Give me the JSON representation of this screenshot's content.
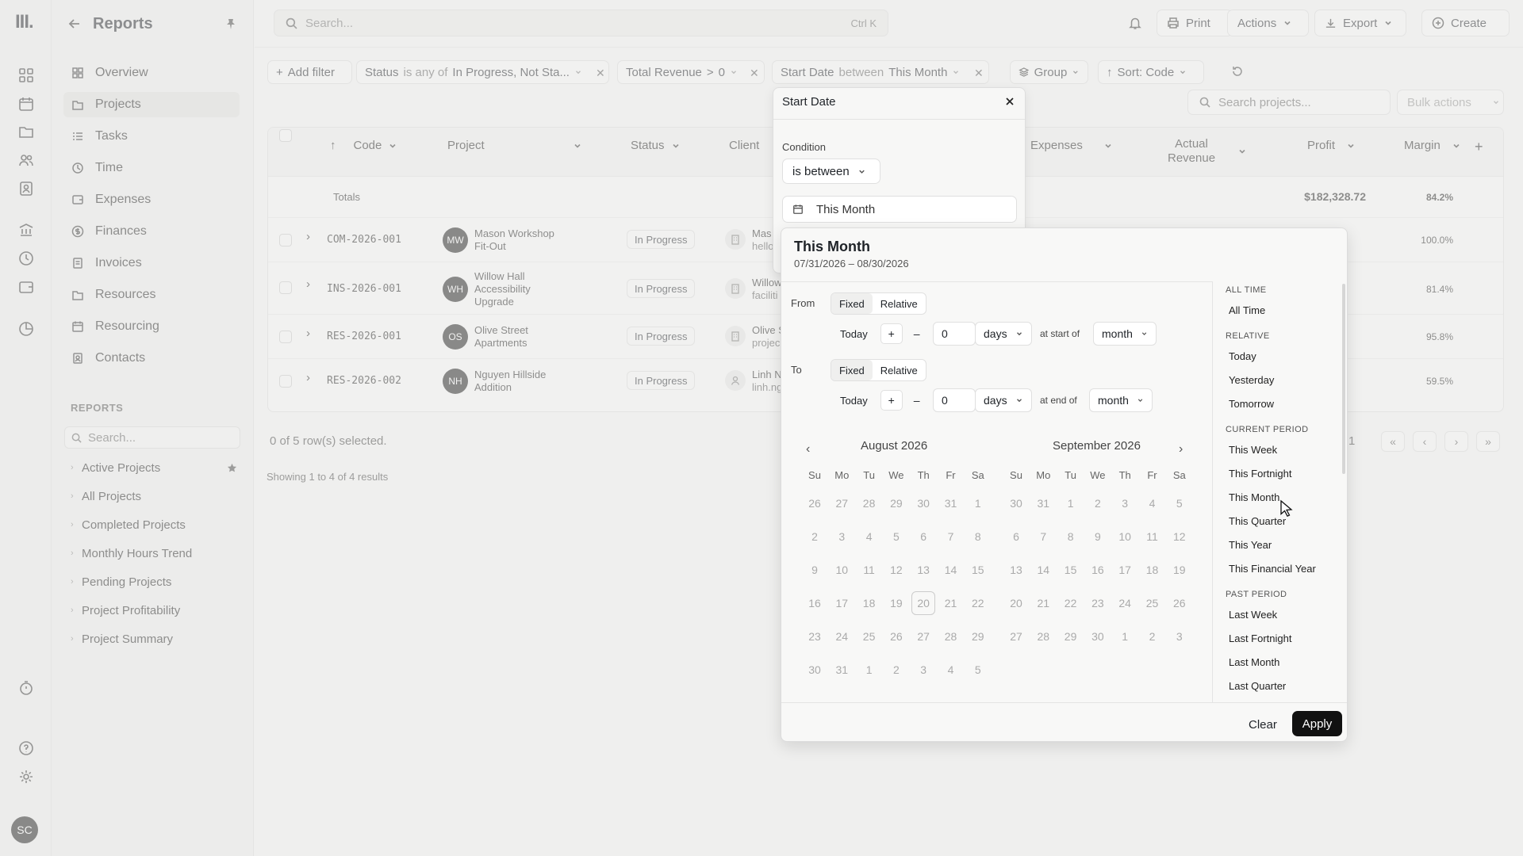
{
  "app": {
    "logo": "III.",
    "user_initials": "SC"
  },
  "sidebar": {
    "title": "Reports",
    "nav": [
      {
        "label": "Overview",
        "icon": "grid-icon"
      },
      {
        "label": "Projects",
        "icon": "projects-icon",
        "active": true
      },
      {
        "label": "Tasks",
        "icon": "tasks-icon"
      },
      {
        "label": "Time",
        "icon": "clock-icon"
      },
      {
        "label": "Expenses",
        "icon": "wallet-icon"
      },
      {
        "label": "Finances",
        "icon": "dollar-icon"
      },
      {
        "label": "Invoices",
        "icon": "invoice-icon"
      },
      {
        "label": "Resources",
        "icon": "folder-icon"
      },
      {
        "label": "Resourcing",
        "icon": "calendar-icon"
      },
      {
        "label": "Contacts",
        "icon": "contacts-icon"
      }
    ],
    "reports_label": "REPORTS",
    "reports_search_placeholder": "Search...",
    "reports": [
      "Active Projects",
      "All Projects",
      "Completed Projects",
      "Monthly Hours Trend",
      "Pending Projects",
      "Project Profitability",
      "Project Summary"
    ]
  },
  "topbar": {
    "search_placeholder": "Search...",
    "search_shortcut": "Ctrl K",
    "print": "Print",
    "actions": "Actions",
    "export": "Export",
    "create": "Create"
  },
  "filters": {
    "add_filter": "Add filter",
    "status": {
      "field": "Status",
      "op": "is any of",
      "value": "In Progress, Not Sta..."
    },
    "revenue": {
      "field": "Total Revenue",
      "op": ">",
      "value": "0"
    },
    "start_date": {
      "field": "Start Date",
      "op": "between",
      "value": "This Month"
    },
    "group": "Group",
    "sort": "Sort: Code"
  },
  "table": {
    "search_placeholder": "Search projects...",
    "bulk_actions": "Bulk actions",
    "columns": {
      "code": "Code",
      "project": "Project",
      "status": "Status",
      "client": "Client",
      "expenses": "Expenses",
      "actual_revenue_1": "Actual",
      "actual_revenue_2": "Revenue",
      "profit": "Profit",
      "margin": "Margin"
    },
    "totals": {
      "label": "Totals",
      "profit": "$182,328.72",
      "margin": "84.2%"
    },
    "rows": [
      {
        "code": "COM-2026-001",
        "initials": "MW",
        "project_1": "Mason Workshop",
        "project_2": "Fit-Out",
        "project_3": "",
        "status": "In Progress",
        "client_1": "Mas",
        "client_2": "hello",
        "client_icon": "building-icon",
        "margin": "100.0%"
      },
      {
        "code": "INS-2026-001",
        "initials": "WH",
        "project_1": "Willow Hall",
        "project_2": "Accessibility",
        "project_3": "Upgrade",
        "status": "In Progress",
        "client_1": "Willow",
        "client_2": "faciliti",
        "client_icon": "building-icon",
        "margin": "81.4%"
      },
      {
        "code": "RES-2026-001",
        "initials": "OS",
        "project_1": "Olive Street",
        "project_2": "Apartments",
        "project_3": "",
        "status": "In Progress",
        "client_1": "Olive S",
        "client_2": "projec",
        "client_icon": "building-icon",
        "margin": "95.8%"
      },
      {
        "code": "RES-2026-002",
        "initials": "NH",
        "project_1": "Nguyen Hillside",
        "project_2": "Addition",
        "project_3": "",
        "status": "In Progress",
        "client_1": "Linh N",
        "client_2": "linh.ng",
        "client_icon": "person-icon",
        "margin": "59.5%"
      }
    ],
    "selected_text": "0 of 5 row(s) selected.",
    "showing_text": "Showing 1 to 4 of 4 results",
    "page": "1"
  },
  "popover": {
    "title": "Start Date",
    "condition_label": "Condition",
    "condition_value": "is between",
    "date_value": "This Month"
  },
  "date_panel": {
    "title": "This Month",
    "range": "07/31/2026 – 08/30/2026",
    "from_label": "From",
    "to_label": "To",
    "fixed": "Fixed",
    "relative": "Relative",
    "today": "Today",
    "plus": "+",
    "minus": "–",
    "from_amount": "0",
    "to_amount": "0",
    "unit": "days",
    "at_start_of": "at start of",
    "at_end_of": "at end of",
    "period": "month",
    "cal_left_title": "August 2026",
    "cal_right_title": "September 2026",
    "weekdays": [
      "Su",
      "Mo",
      "Tu",
      "We",
      "Th",
      "Fr",
      "Sa"
    ],
    "aug_days": [
      "26",
      "27",
      "28",
      "29",
      "30",
      "31",
      "1",
      "2",
      "3",
      "4",
      "5",
      "6",
      "7",
      "8",
      "9",
      "10",
      "11",
      "12",
      "13",
      "14",
      "15",
      "16",
      "17",
      "18",
      "19",
      "20",
      "21",
      "22",
      "23",
      "24",
      "25",
      "26",
      "27",
      "28",
      "29",
      "30",
      "31",
      "1",
      "2",
      "3",
      "4",
      "5"
    ],
    "sep_days": [
      "30",
      "31",
      "1",
      "2",
      "3",
      "4",
      "5",
      "6",
      "7",
      "8",
      "9",
      "10",
      "11",
      "12",
      "13",
      "14",
      "15",
      "16",
      "17",
      "18",
      "19",
      "20",
      "21",
      "22",
      "23",
      "24",
      "25",
      "26",
      "27",
      "28",
      "29",
      "30",
      "1",
      "2",
      "3"
    ],
    "today_date": "20",
    "preset_groups": [
      {
        "heading": "ALL TIME",
        "items": [
          "All Time"
        ]
      },
      {
        "heading": "RELATIVE",
        "items": [
          "Today",
          "Yesterday",
          "Tomorrow"
        ]
      },
      {
        "heading": "CURRENT PERIOD",
        "items": [
          "This Week",
          "This Fortnight",
          "This Month",
          "This Quarter",
          "This Year",
          "This Financial Year"
        ]
      },
      {
        "heading": "PAST PERIOD",
        "items": [
          "Last Week",
          "Last Fortnight",
          "Last Month",
          "Last Quarter"
        ]
      }
    ],
    "clear": "Clear",
    "apply": "Apply"
  }
}
